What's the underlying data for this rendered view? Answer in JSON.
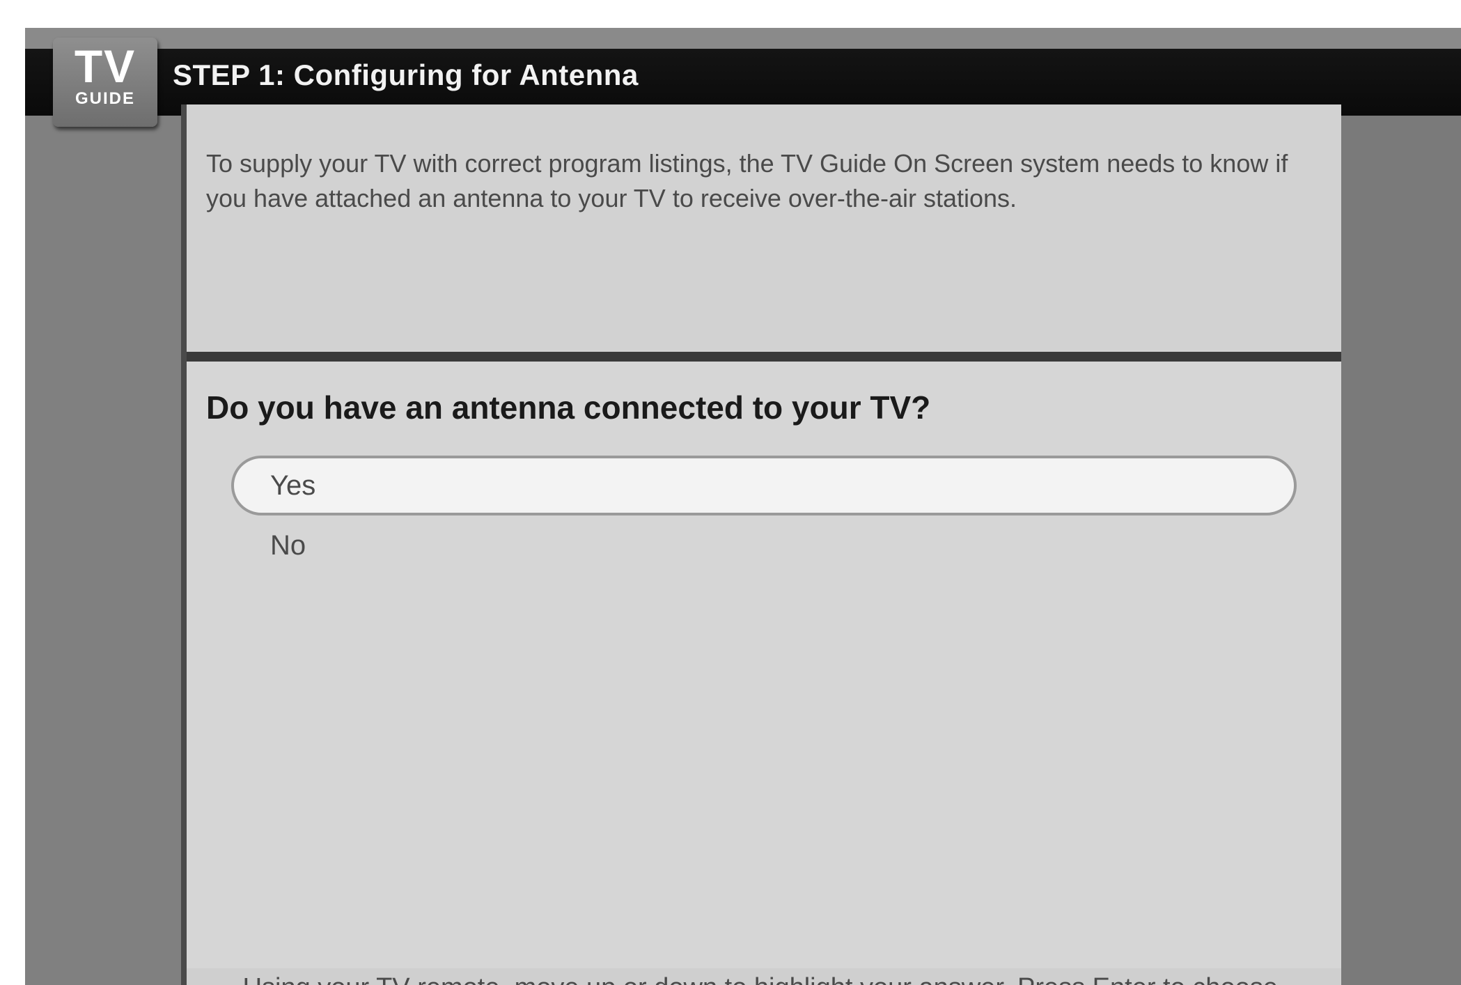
{
  "header": {
    "logo_main": "TV",
    "logo_sub": "GUIDE",
    "title": "STEP 1: Configuring for Antenna"
  },
  "intro": {
    "text": "To supply your TV with correct program listings, the TV Guide On Screen system needs to know if you have attached an antenna to your TV to receive over-the-air stations."
  },
  "question": {
    "text": "Do you have an antenna connected to your TV?"
  },
  "options": [
    {
      "label": "Yes",
      "selected": true
    },
    {
      "label": "No",
      "selected": false
    }
  ],
  "footer": {
    "instruction": "Using your TV remote, move up or down to highlight your answer. Press Enter to choose."
  }
}
